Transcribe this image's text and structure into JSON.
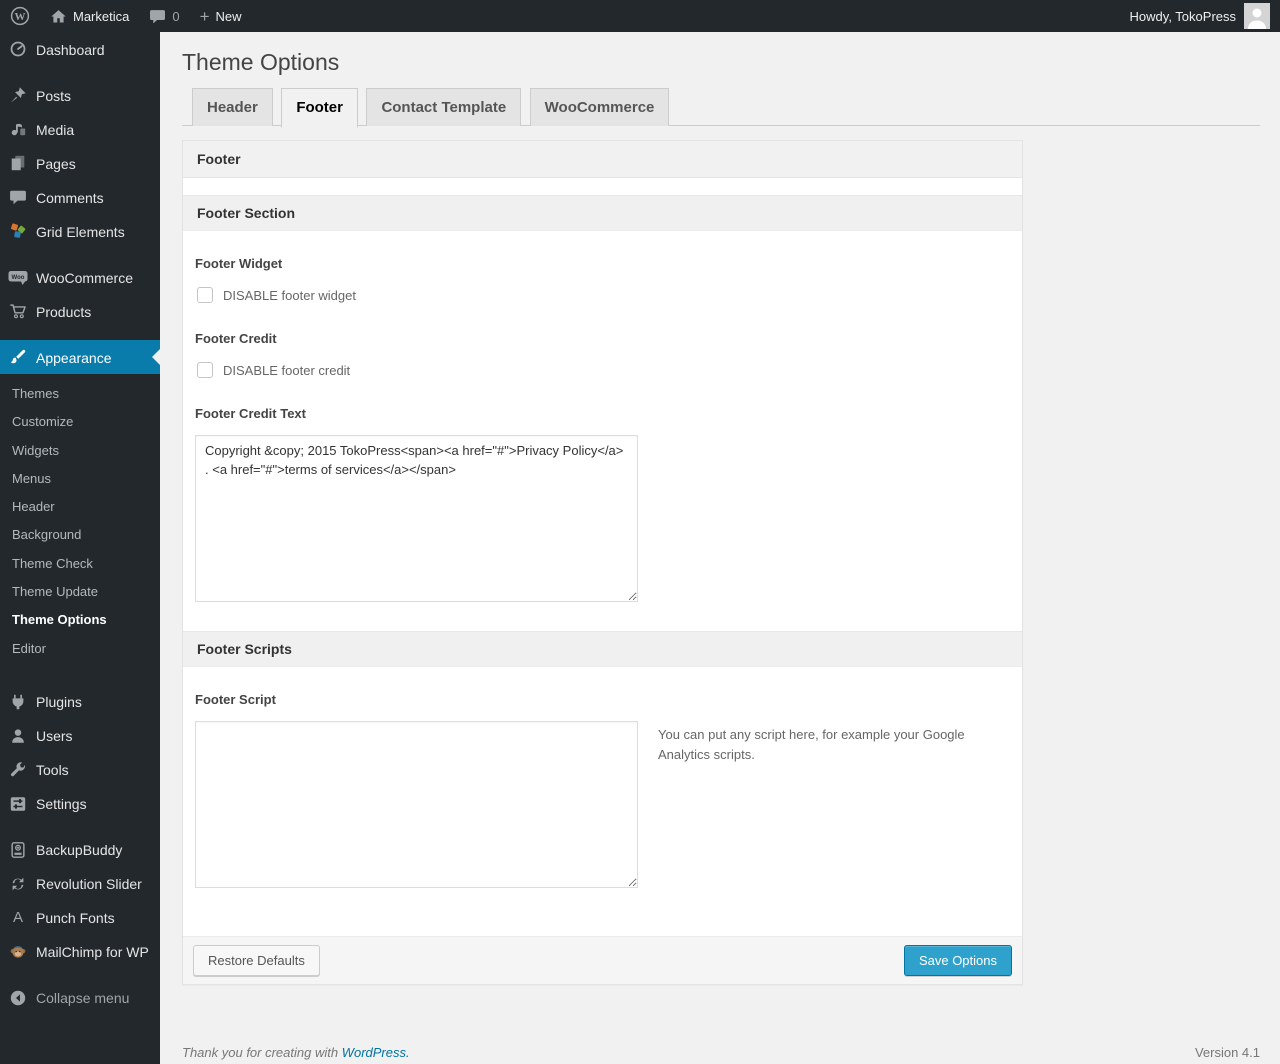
{
  "admin_bar": {
    "site_name": "Marketica",
    "comments_count": "0",
    "new_label": "New",
    "howdy": "Howdy, TokoPress"
  },
  "sidebar": {
    "items": [
      {
        "label": "Dashboard",
        "icon": "dashboard-icon"
      },
      {
        "label": "Posts",
        "icon": "pushpin-icon"
      },
      {
        "label": "Media",
        "icon": "media-icon"
      },
      {
        "label": "Pages",
        "icon": "pages-icon"
      },
      {
        "label": "Comments",
        "icon": "comment-bubble-icon"
      },
      {
        "label": "Grid Elements",
        "icon": "grid-elements-icon"
      },
      {
        "label": "WooCommerce",
        "icon": "woocommerce-icon"
      },
      {
        "label": "Products",
        "icon": "cart-icon"
      },
      {
        "label": "Appearance",
        "icon": "paintbrush-icon",
        "active": true
      },
      {
        "label": "Plugins",
        "icon": "plugin-icon"
      },
      {
        "label": "Users",
        "icon": "user-icon"
      },
      {
        "label": "Tools",
        "icon": "wrench-icon"
      },
      {
        "label": "Settings",
        "icon": "sliders-icon"
      },
      {
        "label": "BackupBuddy",
        "icon": "backup-drive-icon"
      },
      {
        "label": "Revolution Slider",
        "icon": "refresh-arrows-icon"
      },
      {
        "label": "Punch Fonts",
        "icon": "letter-a-icon"
      },
      {
        "label": "MailChimp for WP",
        "icon": "monkey-icon"
      },
      {
        "label": "Collapse menu",
        "icon": "collapse-arrow-icon"
      }
    ],
    "appearance_submenu": [
      "Themes",
      "Customize",
      "Widgets",
      "Menus",
      "Header",
      "Background",
      "Theme Check",
      "Theme Update",
      "Theme Options",
      "Editor"
    ],
    "current_submenu_item": "Theme Options"
  },
  "page": {
    "title": "Theme Options"
  },
  "tabs": [
    {
      "label": "Header",
      "active": false
    },
    {
      "label": "Footer",
      "active": true
    },
    {
      "label": "Contact Template",
      "active": false
    },
    {
      "label": "WooCommerce",
      "active": false
    }
  ],
  "panel": {
    "title": "Footer",
    "section1_title": "Footer Section",
    "footer_widget_label": "Footer Widget",
    "footer_widget_checkbox": "DISABLE footer widget",
    "footer_credit_label": "Footer Credit",
    "footer_credit_checkbox": "DISABLE footer credit",
    "footer_credit_text_label": "Footer Credit Text",
    "footer_credit_text_value": "Copyright &copy; 2015 TokoPress<span><a href=\"#\">Privacy Policy</a> . <a href=\"#\">terms of services</a></span>",
    "section2_title": "Footer Scripts",
    "footer_script_label": "Footer Script",
    "footer_script_value": "",
    "footer_script_help": "You can put any script here, for example your Google Analytics scripts.",
    "restore_button": "Restore Defaults",
    "save_button": "Save Options"
  },
  "page_footer": {
    "thanks_prefix": "Thank you for creating with ",
    "wordpress_link": "WordPress.",
    "version": "Version 4.1"
  },
  "colors": {
    "admin_dark": "#23282d",
    "menu_highlight_blue": "#0a7cab",
    "primary_button_blue": "#2ea2cc",
    "link_blue": "#0074a2",
    "content_background": "#f1f1f1"
  }
}
